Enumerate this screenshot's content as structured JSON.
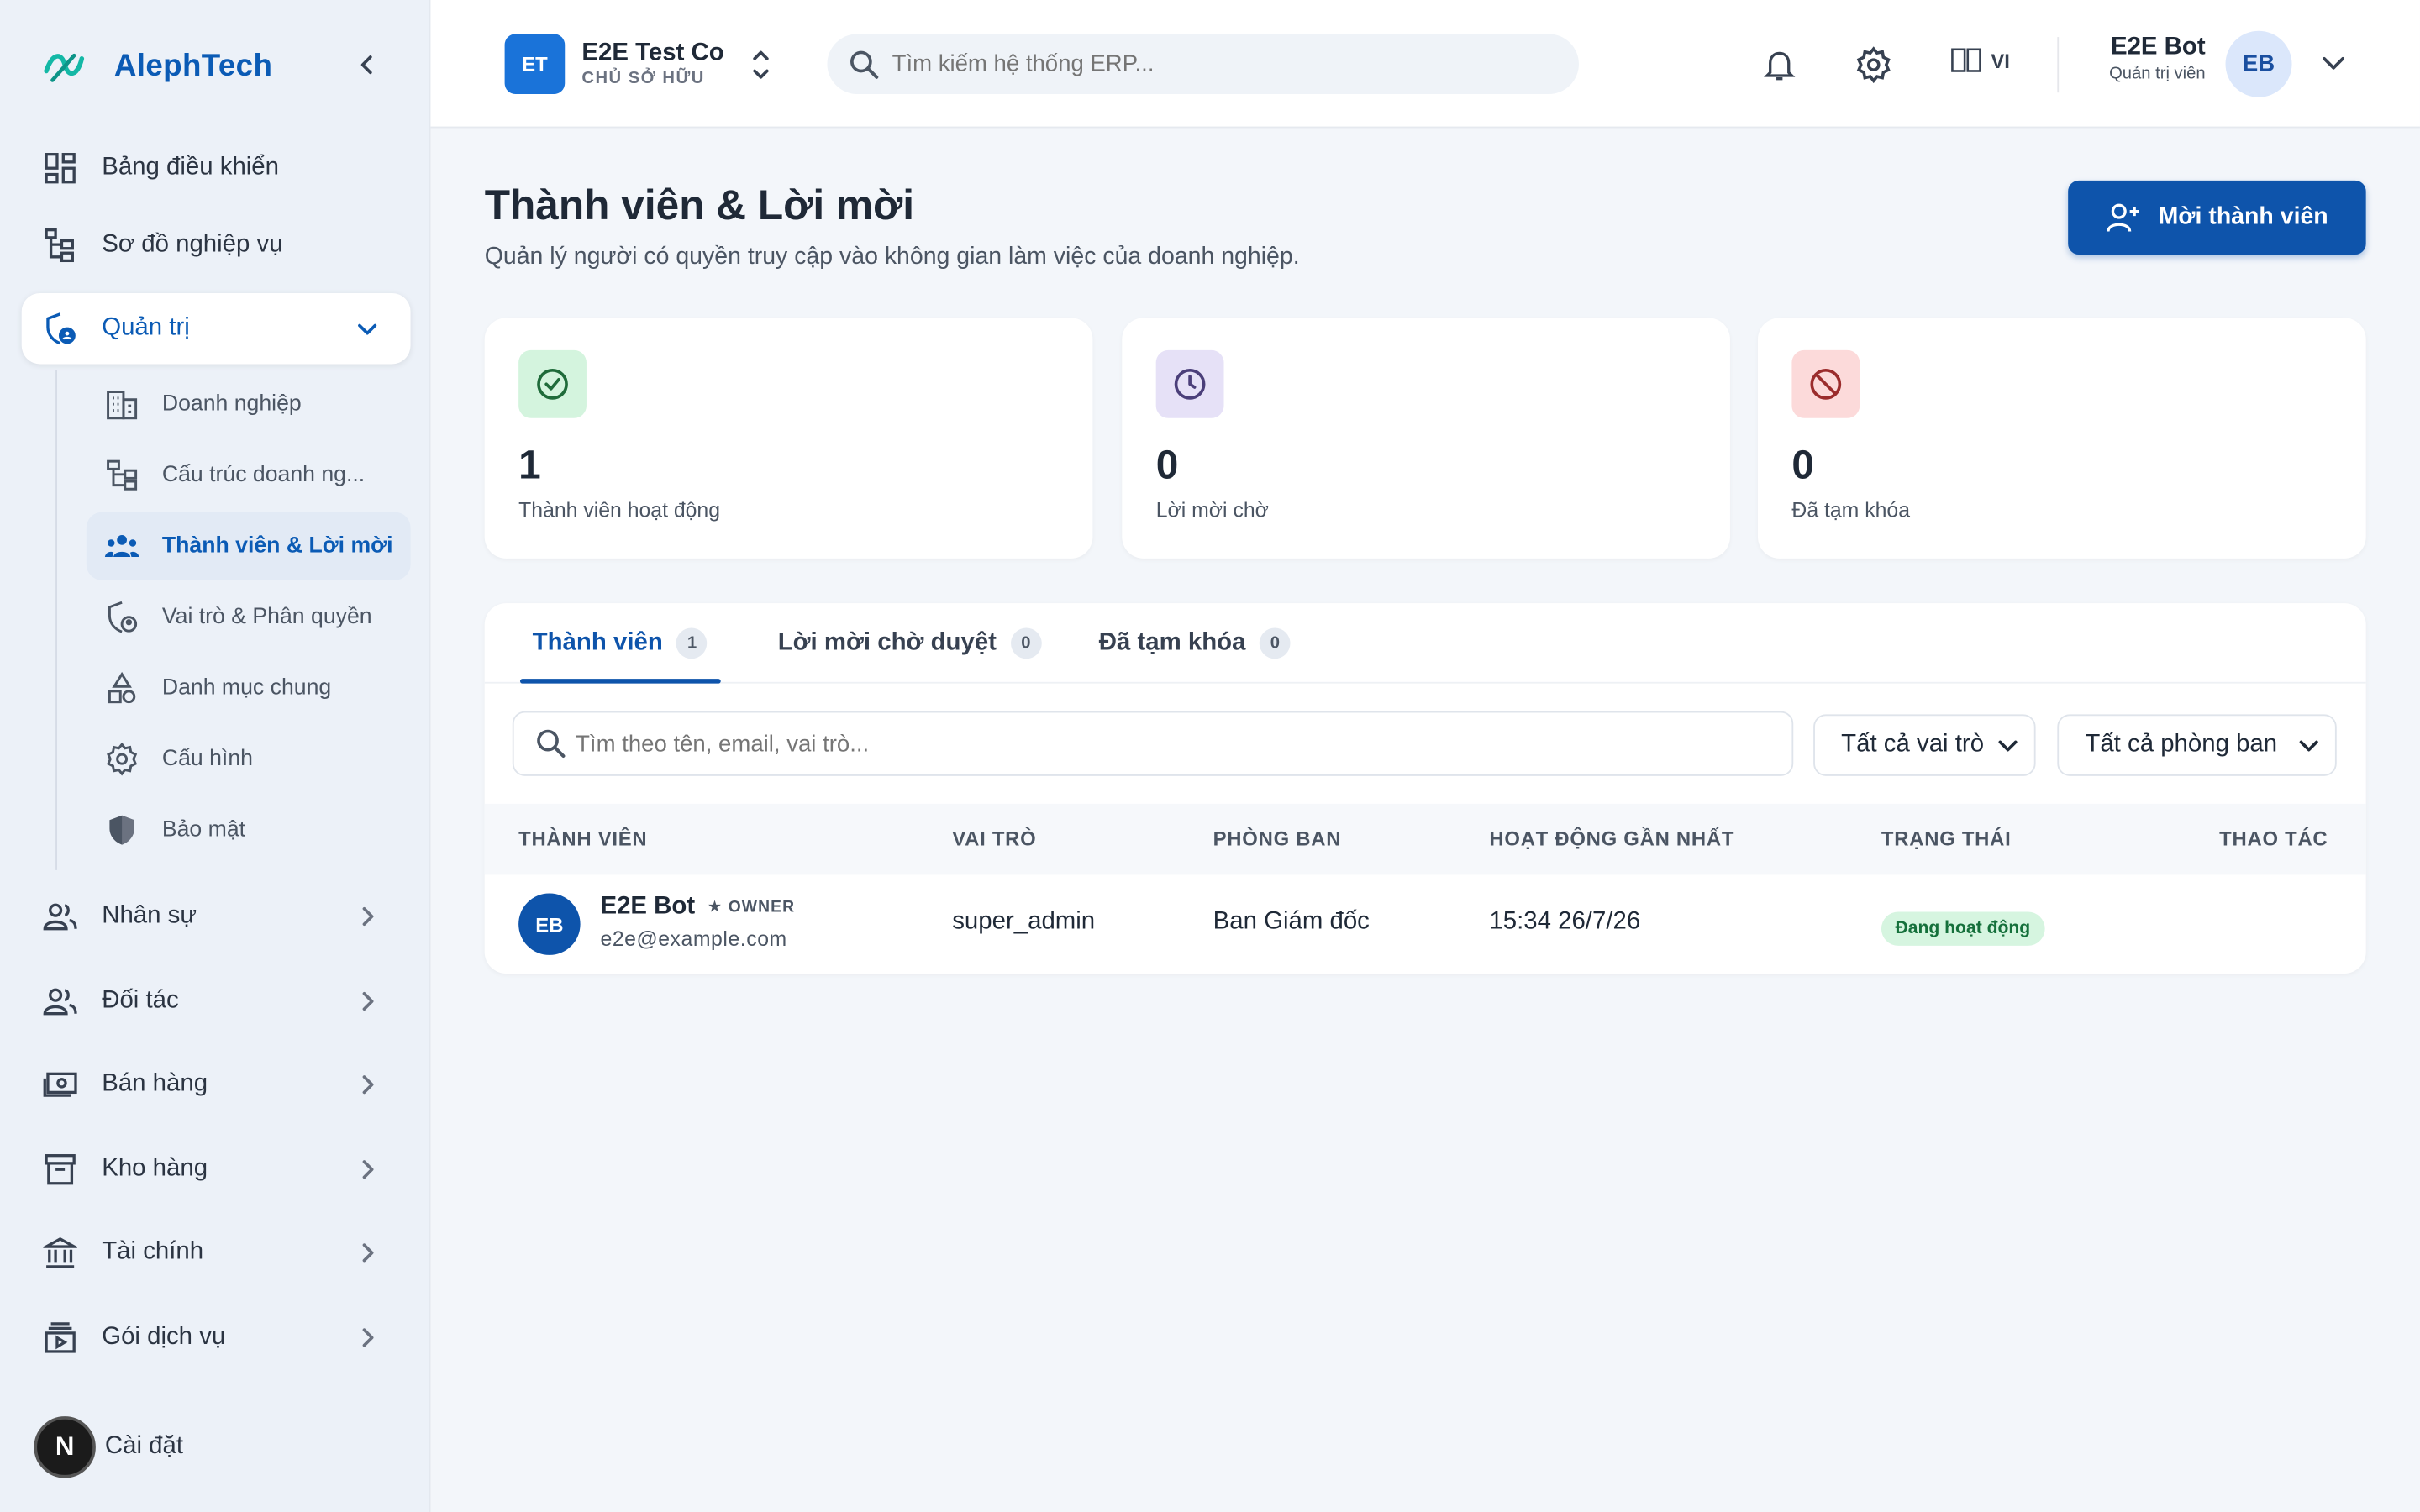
{
  "brand": {
    "name": "AlephTech"
  },
  "sidebar": {
    "items": [
      {
        "label": "Bảng điều khiển",
        "icon": "dashboard-icon"
      },
      {
        "label": "Sơ đồ nghiệp vụ",
        "icon": "flow-icon"
      },
      {
        "label": "Quản trị",
        "icon": "admin-shield-icon"
      }
    ],
    "sub_items": [
      {
        "label": "Doanh nghiệp",
        "icon": "building-icon"
      },
      {
        "label": "Cấu trúc doanh ng...",
        "icon": "structure-icon"
      },
      {
        "label": "Thành viên & Lời mời",
        "icon": "members-icon"
      },
      {
        "label": "Vai trò & Phân quyền",
        "icon": "role-shield-icon"
      },
      {
        "label": "Danh mục chung",
        "icon": "shapes-icon"
      },
      {
        "label": "Cấu hình",
        "icon": "gear-icon"
      },
      {
        "label": "Bảo mật",
        "icon": "security-icon"
      }
    ],
    "groups": [
      {
        "label": "Nhân sự",
        "icon": "people-icon"
      },
      {
        "label": "Đối tác",
        "icon": "partner-icon"
      },
      {
        "label": "Bán hàng",
        "icon": "cash-icon"
      },
      {
        "label": "Kho hàng",
        "icon": "archive-icon"
      },
      {
        "label": "Tài chính",
        "icon": "bank-icon"
      },
      {
        "label": "Gói dịch vụ",
        "icon": "subscription-icon"
      }
    ],
    "settings_label": "Cài đặt",
    "n_badge": "N"
  },
  "header": {
    "company_initials": "ET",
    "company_name": "E2E Test Co",
    "company_role": "CHỦ SỞ HỮU",
    "search_placeholder": "Tìm kiếm hệ thống ERP...",
    "language": "VI",
    "user_name": "E2E Bot",
    "user_role": "Quản trị viên",
    "user_initials": "EB"
  },
  "page": {
    "title": "Thành viên & Lời mời",
    "subtitle": "Quản lý người có quyền truy cập vào không gian làm việc của doanh nghiệp.",
    "invite_label": "Mời thành viên"
  },
  "stats": [
    {
      "value": "1",
      "label": "Thành viên hoạt động",
      "color": "#d4f4de"
    },
    {
      "value": "0",
      "label": "Lời mời chờ",
      "color": "#e6e1f7"
    },
    {
      "value": "0",
      "label": "Đã tạm khóa",
      "color": "#fcdada"
    }
  ],
  "tabs": [
    {
      "label": "Thành viên",
      "count": "1"
    },
    {
      "label": "Lời mời chờ duyệt",
      "count": "0"
    },
    {
      "label": "Đã tạm khóa",
      "count": "0"
    }
  ],
  "filters": {
    "search_placeholder": "Tìm theo tên, email, vai trò...",
    "role_select": "Tất cả vai trò",
    "dept_select": "Tất cả phòng ban"
  },
  "table": {
    "headers": [
      "THÀNH VIÊN",
      "VAI TRÒ",
      "PHÒNG BAN",
      "HOẠT ĐỘNG GẦN NHẤT",
      "TRẠNG THÁI",
      "THAO TÁC"
    ],
    "rows": [
      {
        "initials": "EB",
        "name": "E2E Bot",
        "owner_tag": "★ OWNER",
        "email": "e2e@example.com",
        "role": "super_admin",
        "department": "Ban Giám đốc",
        "last_active": "15:34 26/7/26",
        "status": "Đang hoạt động"
      }
    ]
  },
  "colors": {
    "primary": "#0e54ab",
    "accent_blue": "#0b5bb5",
    "sidebar_bg": "#ecf1f8",
    "status_green_bg": "#d6f5e0",
    "status_green_text": "#15703b"
  }
}
